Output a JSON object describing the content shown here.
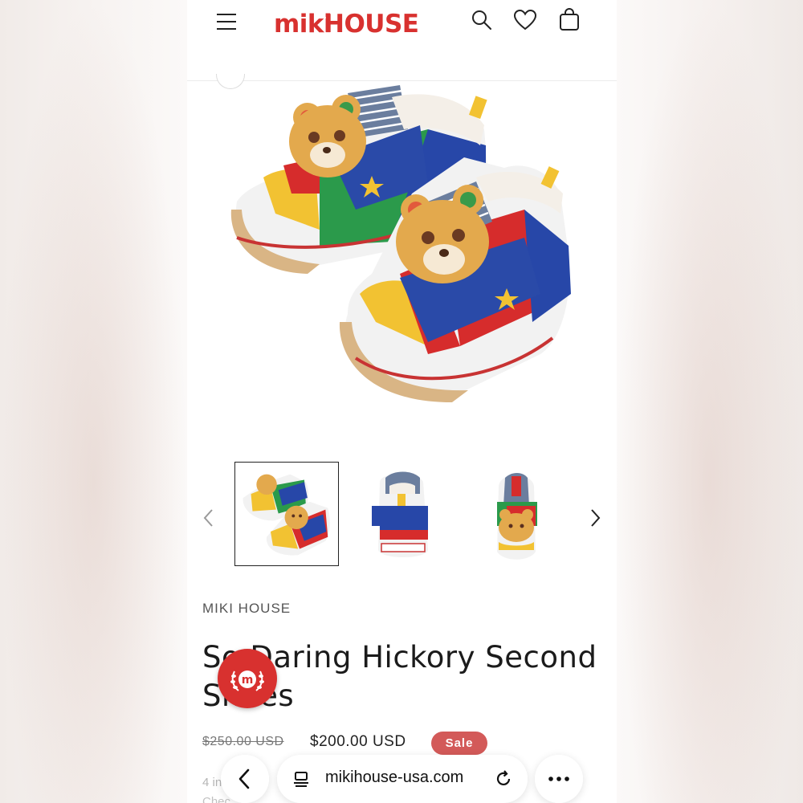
{
  "header": {
    "logo_text": "mikiHOUSE",
    "icons": [
      "menu-icon",
      "search-icon",
      "heart-icon",
      "cart-icon"
    ]
  },
  "product": {
    "brand": "MIKI HOUSE",
    "title": "So Daring Hickory Second Shoes",
    "price_old": "$250.00 USD",
    "price_new": "$200.00 USD",
    "sale_label": "Sale",
    "below_text": "4 in",
    "below_text2": "Chec"
  },
  "gallery": {
    "thumbnail_count": 3,
    "active_index": 0
  },
  "browser": {
    "url": "mikihouse-usa.com",
    "icons": [
      "back-icon",
      "tabs-icon",
      "reload-icon",
      "more-icon"
    ]
  },
  "colors": {
    "brand_red": "#d8312f",
    "sale_badge": "#d35a59"
  }
}
